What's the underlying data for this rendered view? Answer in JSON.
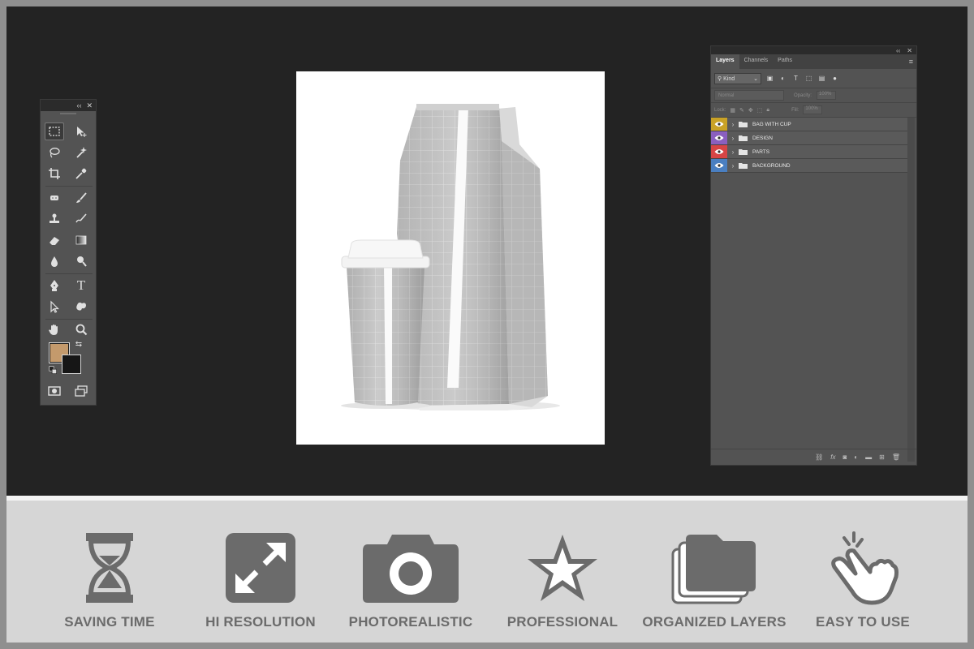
{
  "tools_panel": {
    "collapse_glyph": "‹‹",
    "close_glyph": "✕",
    "foreground_color": "#c49a6c",
    "background_color": "#161616",
    "tools": [
      "rectangular-marquee-icon",
      "move-icon",
      "lasso-icon",
      "magic-wand-icon",
      "crop-icon",
      "eyedropper-icon",
      "healing-brush-icon",
      "brush-icon",
      "clone-stamp-icon",
      "history-brush-icon",
      "eraser-icon",
      "gradient-icon",
      "blur-icon",
      "dodge-icon",
      "pen-icon",
      "type-icon",
      "path-selection-icon",
      "custom-shape-icon",
      "hand-icon",
      "zoom-icon"
    ],
    "type_tool_glyph": "T"
  },
  "layers_panel": {
    "tabs": [
      {
        "label": "Layers",
        "active": true
      },
      {
        "label": "Channels",
        "active": false
      },
      {
        "label": "Paths",
        "active": false
      }
    ],
    "filter_kind": "Kind",
    "blend_mode": "Normal",
    "opacity_label": "Opacity:",
    "opacity_value": "100%",
    "lock_label": "Lock:",
    "fill_label": "Fill:",
    "fill_value": "100%",
    "layers": [
      {
        "name": "BAG WITH CUP",
        "color": "#c9a227"
      },
      {
        "name": "DESIGN",
        "color": "#8a5fbf"
      },
      {
        "name": "PARTS",
        "color": "#d64545"
      },
      {
        "name": "BACKGROUND",
        "color": "#4a7fc1"
      }
    ],
    "bottom_icons": [
      "link-layers-icon",
      "fx-icon",
      "mask-icon",
      "adjustment-icon",
      "new-group-icon",
      "new-layer-icon",
      "delete-icon"
    ]
  },
  "features": [
    {
      "label": "SAVING TIME",
      "icon": "hourglass-icon"
    },
    {
      "label": "HI RESOLUTION",
      "icon": "expand-icon"
    },
    {
      "label": "PHOTOREALISTIC",
      "icon": "camera-icon"
    },
    {
      "label": "PROFESSIONAL",
      "icon": "star-icon"
    },
    {
      "label": "ORGANIZED LAYERS",
      "icon": "layers-icon"
    },
    {
      "label": "EASY TO USE",
      "icon": "pointer-hand-icon"
    }
  ],
  "colors": {
    "workspace": "#232323",
    "panel": "#535353",
    "feature_icon": "#6b6b6b",
    "feature_bar": "#d6d6d6"
  }
}
